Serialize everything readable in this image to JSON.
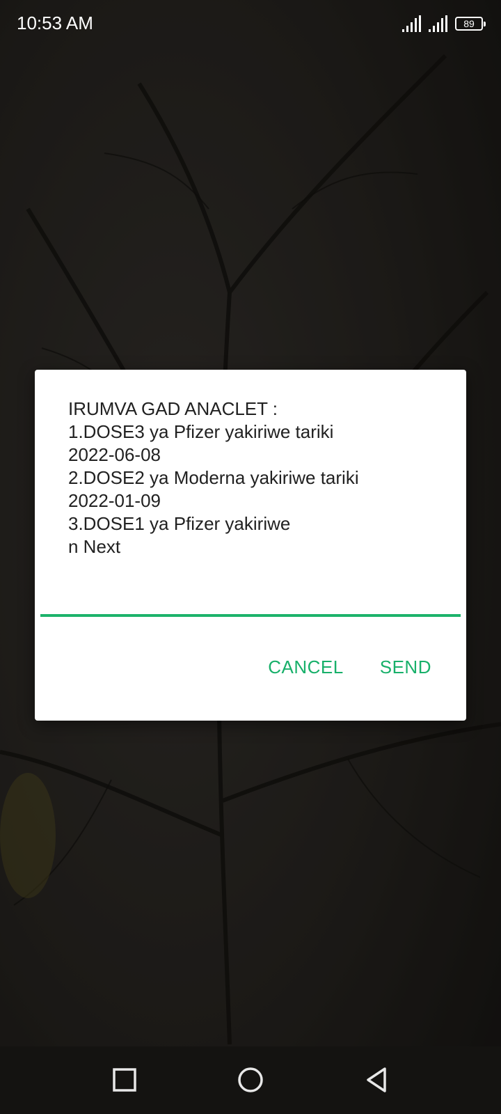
{
  "status_bar": {
    "time": "10:53 AM",
    "battery_level": "89",
    "icons": [
      "signal-icon",
      "signal-icon",
      "battery-icon"
    ]
  },
  "dialog": {
    "message": "IRUMVA GAD ANACLET :\n1.DOSE3 ya Pfizer yakiriwe tariki\n2022-06-08\n2.DOSE2 ya Moderna yakiriwe tariki\n2022-01-09\n3.DOSE1 ya Pfizer yakiriwe\nn Next",
    "input_value": "",
    "accent_color": "#1db36b",
    "cancel_label": "CANCEL",
    "send_label": "SEND"
  },
  "nav_bar": {
    "buttons": [
      "recents-icon",
      "home-icon",
      "back-icon"
    ]
  }
}
